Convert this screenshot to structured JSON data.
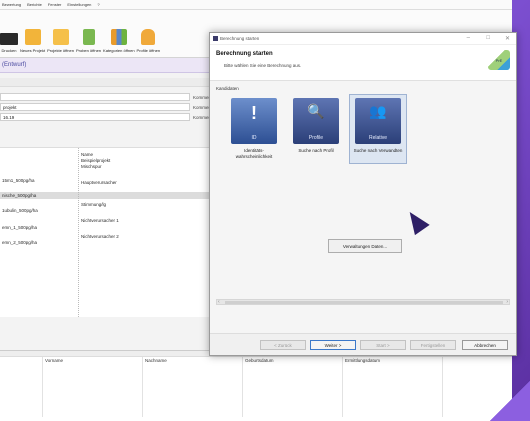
{
  "app": {
    "menu": [
      "Bewertung",
      "Berichte",
      "Fenster",
      "Einstellungen",
      "?"
    ],
    "toolbar": [
      {
        "label": "Drucken",
        "icon": "printer-icon"
      },
      {
        "label": "Neues Projekt",
        "icon": "new-folder-icon"
      },
      {
        "label": "Projekte öffnen",
        "icon": "open-folder-icon"
      },
      {
        "label": "Proben öffnen",
        "icon": "sample-box-icon"
      },
      {
        "label": "Kategorien öffnen",
        "icon": "categories-icon"
      },
      {
        "label": "Profile öffnen",
        "icon": "people-icon"
      }
    ],
    "doc_title": "(Entwurf)",
    "fields": [
      {
        "value": "",
        "label": "Kommentar"
      },
      {
        "value": "projekt",
        "label": "Kommentar"
      },
      {
        "value": "16.19",
        "label": "Kommentar"
      }
    ],
    "tree_left": [
      {
        "text": "15m1_500pg/ha",
        "row": 0
      },
      {
        "text": "nische_500pg/ha",
        "row": 1
      },
      {
        "text": "1ubulin_500pg/ha",
        "row": 2
      },
      {
        "text": "emn_1_500pg/ha",
        "row": 3
      },
      {
        "text": "emn_2_500pg/ha",
        "row": 4
      }
    ],
    "tree_right": [
      "Name",
      "Beispielprojekt",
      "Mischspur",
      "Hauptverursacher",
      "Stimmung/lg",
      "Nichtverursacher 1",
      "Nichtverursacher 2"
    ],
    "bottom_headers": [
      "Vorname",
      "Nachname",
      "Geburtsdatum",
      "Ermittlungsdatum"
    ]
  },
  "dialog": {
    "window_title": "Berechnung starten",
    "header_title": "Berechnung starten",
    "header_subtitle": "Bitte wählen Sie eine Berechnung aus.",
    "logo_text": "PrE",
    "group_label": "Kandidaten",
    "tiles": [
      {
        "caption": "ID",
        "glyph": "!",
        "label": "Identitäts-wahrscheinlichkeit",
        "selected": false,
        "icon": "identity-icon"
      },
      {
        "caption": "Profile",
        "glyph": "🔍",
        "label": "Suche nach Profil",
        "selected": false,
        "icon": "profile-search-icon"
      },
      {
        "caption": "Relative",
        "glyph": "👥",
        "label": "Suche nach Verwandten",
        "selected": true,
        "icon": "relative-search-icon"
      }
    ],
    "customize_button": "Verwaltungen Daten...",
    "footer": {
      "back": "< Zurück",
      "next": "Weiter >",
      "start": "Start >",
      "finish": "Fertigstellen",
      "cancel": "Abbrechen"
    }
  }
}
